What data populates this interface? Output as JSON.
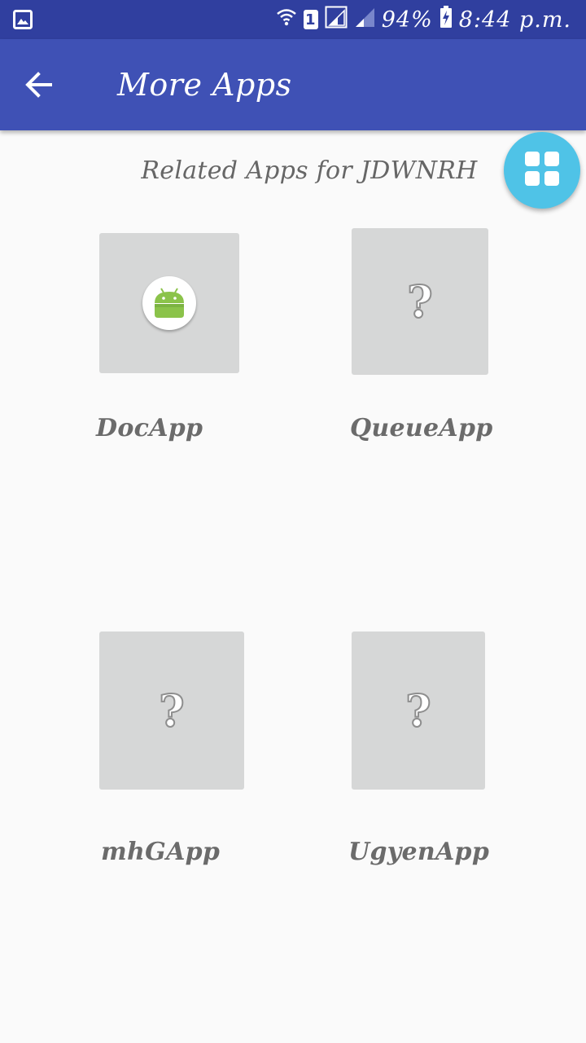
{
  "status_bar": {
    "battery": "94%",
    "time": "8:44 p.m.",
    "sim_slot": "1",
    "icons": [
      "gallery-icon",
      "wifi-icon",
      "sim-icon",
      "signal-icon",
      "signal-icon-2",
      "battery-charging-icon"
    ]
  },
  "app_bar": {
    "title": "More Apps",
    "back_icon": "arrow-back-icon"
  },
  "section": {
    "title": "Related Apps for JDWNRH"
  },
  "fab": {
    "icon": "grid-icon",
    "color": "#4fc3e7"
  },
  "apps": [
    {
      "name": "DocApp",
      "icon": "android-icon"
    },
    {
      "name": "QueueApp",
      "icon": "question-mark-icon"
    },
    {
      "name": "mhGApp",
      "icon": "question-mark-icon"
    },
    {
      "name": "UgyenApp",
      "icon": "question-mark-icon"
    }
  ],
  "colors": {
    "status_bar": "#303f9f",
    "app_bar": "#3f51b5",
    "background": "#fafafa",
    "tile": "#d6d7d7",
    "android_green": "#8bc34a"
  }
}
